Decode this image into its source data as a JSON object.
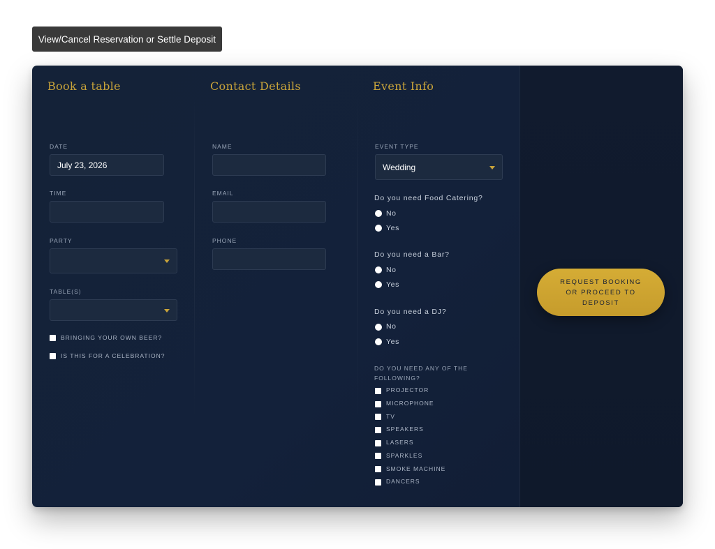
{
  "top_button": {
    "label": "View/Cancel Reservation or Settle Deposit"
  },
  "book": {
    "heading": "Book a table",
    "date_label": "DATE",
    "date_value": "July 23, 2026",
    "time_label": "TIME",
    "time_value": "",
    "party_label": "PARTY",
    "party_value": "",
    "tables_label": "TABLE(S)",
    "tables_value": "",
    "byob_label": "BRINGING YOUR OWN BEER?",
    "celebration_label": "IS THIS FOR A CELEBRATION?"
  },
  "contact": {
    "heading": "Contact Details",
    "name_label": "NAME",
    "name_value": "",
    "email_label": "EMAIL",
    "email_value": "",
    "phone_label": "PHONE",
    "phone_value": ""
  },
  "event": {
    "heading": "Event Info",
    "type_label": "EVENT TYPE",
    "type_value": "Wedding",
    "catering_question": "Do you need Food Catering?",
    "bar_question": "Do you need a Bar?",
    "dj_question": "Do you need a DJ?",
    "no_label": "No",
    "yes_label": "Yes",
    "extras_label": "DO YOU NEED ANY OF THE FOLLOWING?",
    "extras": [
      "PROJECTOR",
      "MICROPHONE",
      "TV",
      "SPEAKERS",
      "LASERS",
      "SPARKLES",
      "SMOKE MACHINE",
      "DANCERS"
    ]
  },
  "submit": {
    "label": "REQUEST BOOKING OR PROCEED TO DEPOSIT"
  },
  "colors": {
    "accent_gold": "#c9a43a",
    "panel_navy": "#13213a",
    "input_bg": "#1c2a3f",
    "top_button_bg": "#3a3a3a"
  }
}
